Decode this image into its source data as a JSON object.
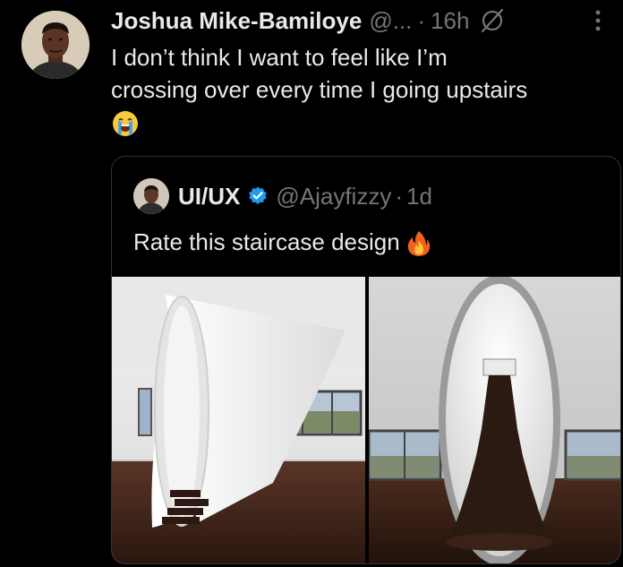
{
  "tweet": {
    "author_name": "Joshua Mike-Bamiloye",
    "author_handle": "@...",
    "separator": "·",
    "time": "16h",
    "text_line1": "I don’t think I want to feel like I’m",
    "text_line2": "crossing over every time I going upstairs",
    "emoji": "loudly-crying-face-emoji"
  },
  "quoted": {
    "author_name": "UI/UX",
    "author_handle": "@Ajayfizzy",
    "separator": "·",
    "time": "1d",
    "text": "Rate this staircase design",
    "emoji": "fire-emoji",
    "media": [
      "white-spiral-staircase-room",
      "egg-shaped-staircase-room"
    ]
  },
  "colors": {
    "background": "#000000",
    "text": "#e7e9ea",
    "secondary": "#71767b",
    "border": "#2f3336",
    "verified": "#1d9bf0"
  },
  "icons": [
    "grok-icon",
    "more-icon",
    "verified-icon"
  ]
}
